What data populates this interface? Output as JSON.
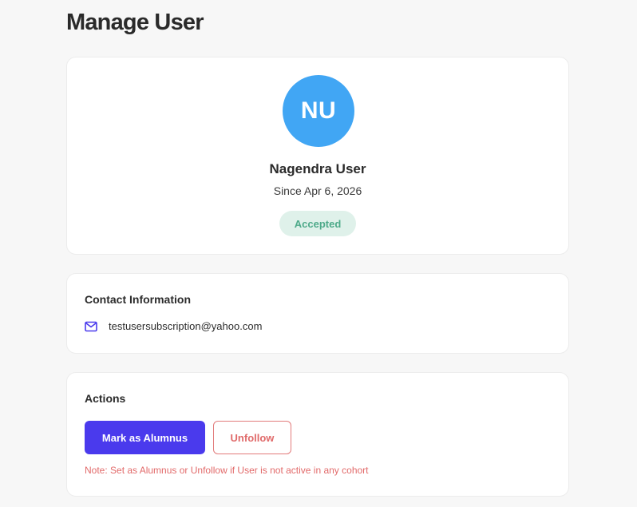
{
  "page": {
    "title": "Manage User"
  },
  "profile": {
    "initials": "NU",
    "name": "Nagendra User",
    "since": "Since Apr 6, 2026",
    "status": "Accepted",
    "avatar_color": "#41a6f4",
    "status_bg_color": "#dff1ea",
    "status_text_color": "#4eaa8a"
  },
  "contact": {
    "title": "Contact Information",
    "email_icon": "mail-icon",
    "email": "testusersubscription@yahoo.com"
  },
  "actions": {
    "title": "Actions",
    "mark_alumnus_label": "Mark as Alumnus",
    "unfollow_label": "Unfollow",
    "note": "Note: Set as Alumnus or Unfollow if User is not active in any cohort",
    "primary_color": "#4a3aed",
    "danger_color": "#e06a6a"
  }
}
